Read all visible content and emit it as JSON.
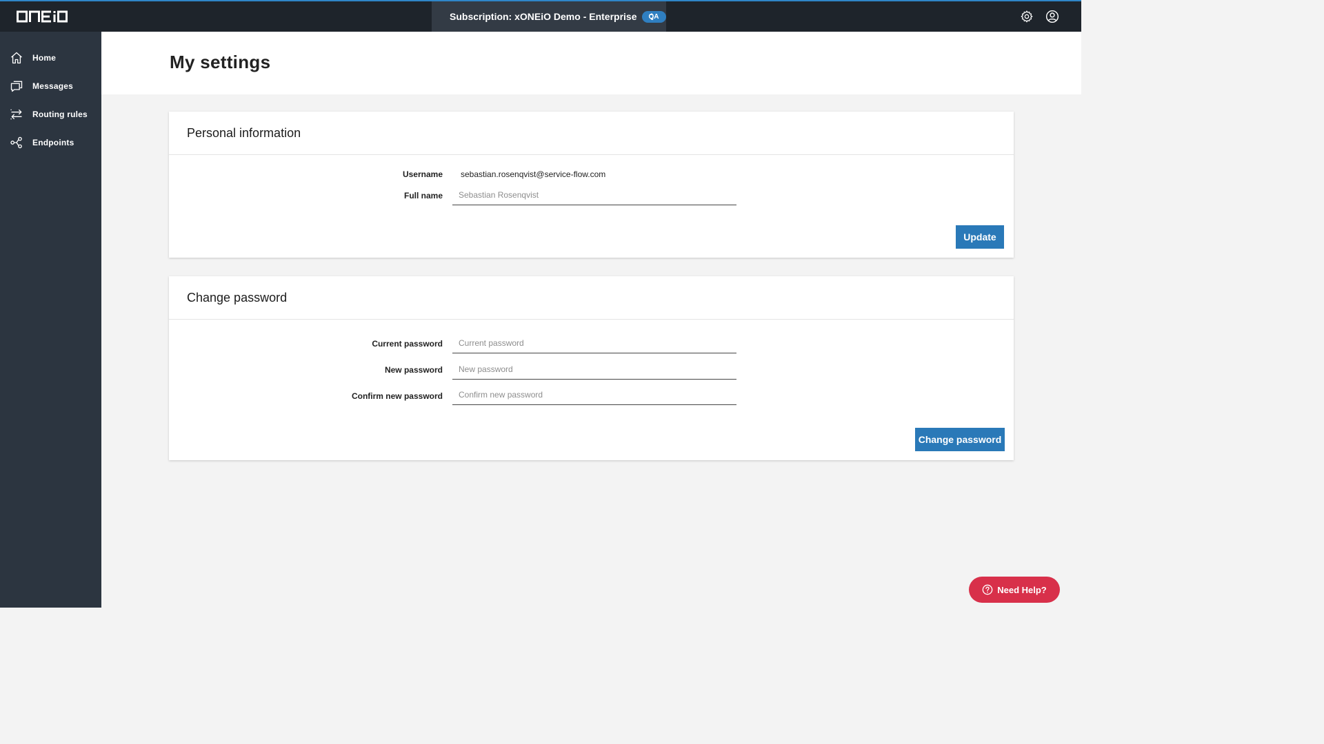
{
  "app": {
    "logo_text": "ONEiO"
  },
  "topbar": {
    "subscription_label": "Subscription: xONEiO Demo - Enterprise",
    "subscription_badge": "QA",
    "settings_icon": "gear-icon",
    "account_icon": "user-circle-icon"
  },
  "sidebar": {
    "items": [
      {
        "label": "Home",
        "icon": "home-icon"
      },
      {
        "label": "Messages",
        "icon": "messages-icon"
      },
      {
        "label": "Routing rules",
        "icon": "routing-arrows-icon"
      },
      {
        "label": "Endpoints",
        "icon": "endpoints-icon"
      }
    ]
  },
  "page": {
    "title": "My settings"
  },
  "personal_info": {
    "title": "Personal information",
    "username_label": "Username",
    "username_value": "sebastian.rosenqvist@service-flow.com",
    "fullname_label": "Full name",
    "fullname_value": "",
    "fullname_placeholder": "Sebastian Rosenqvist",
    "update_button": "Update"
  },
  "change_password": {
    "title": "Change password",
    "current_label": "Current password",
    "current_placeholder": "Current password",
    "new_label": "New password",
    "new_placeholder": "New password",
    "confirm_label": "Confirm new password",
    "confirm_placeholder": "Confirm new password",
    "submit_button": "Change password"
  },
  "help": {
    "label": "Need Help?"
  },
  "colors": {
    "topbar_bg": "#1e242b",
    "sidebar_bg": "#2c3540",
    "accent_blue": "#2a79b8",
    "help_red": "#d8304a"
  }
}
